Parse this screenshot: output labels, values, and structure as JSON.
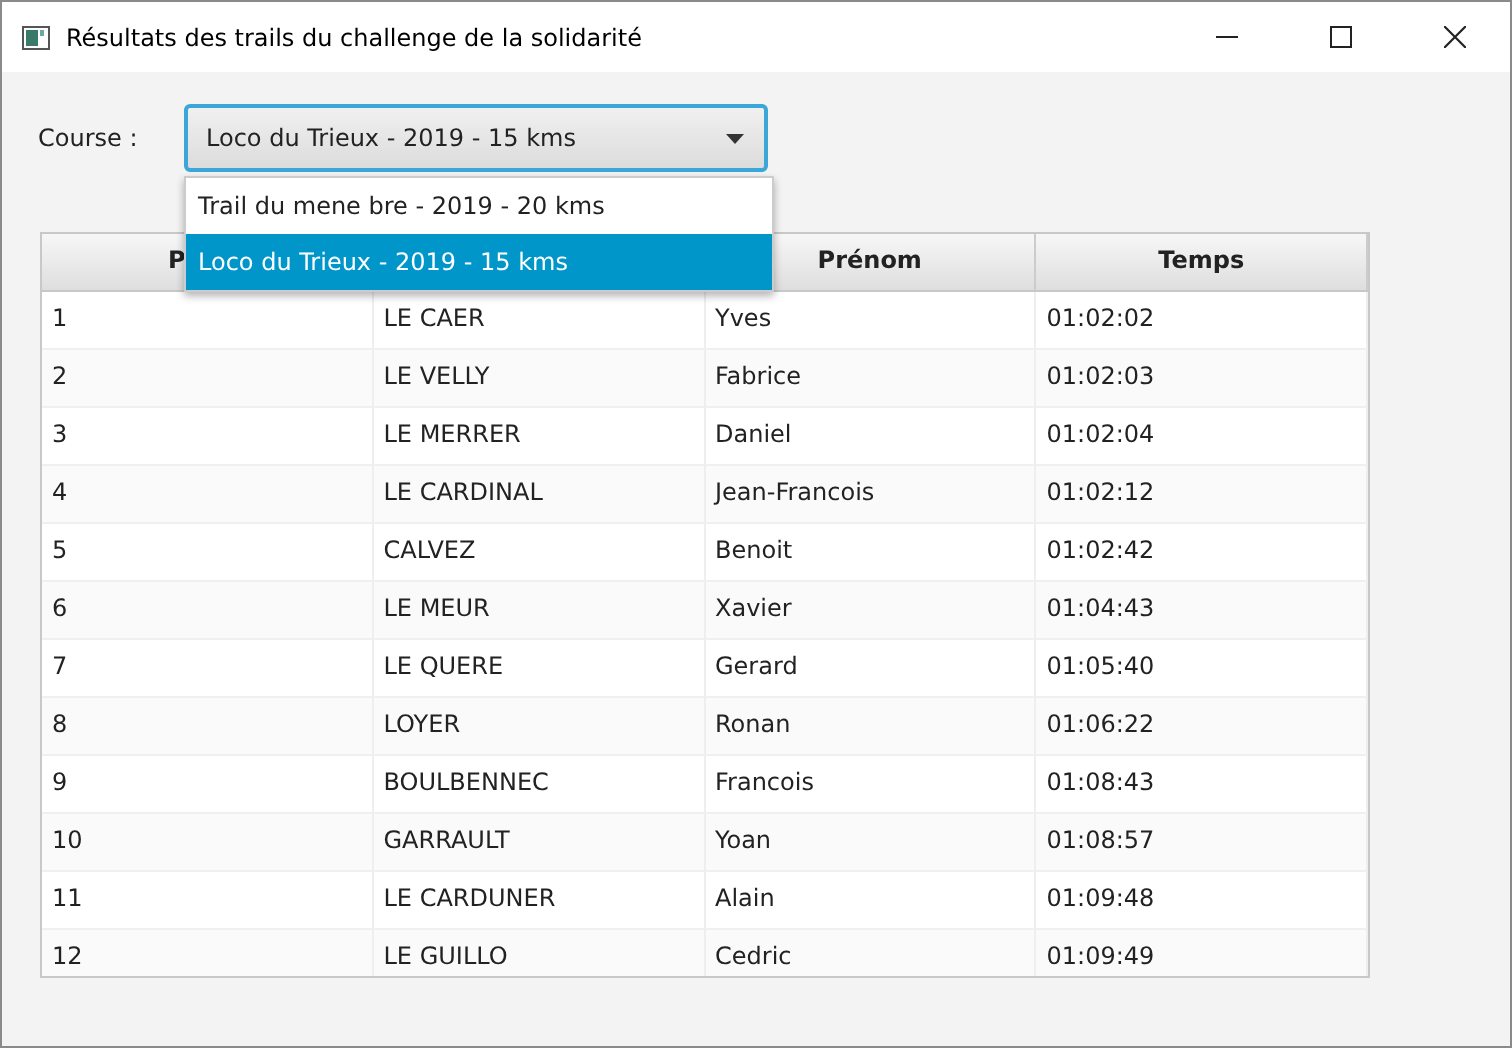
{
  "window": {
    "title": "Résultats des trails du challenge de la solidarité"
  },
  "course": {
    "label": "Course :",
    "value": "Loco du Trieux - 2019 - 15 kms",
    "expanded": true,
    "options": [
      {
        "label": "Trail du mene bre - 2019 - 20 kms",
        "selected": false
      },
      {
        "label": "Loco du Trieux - 2019 - 15 kms",
        "selected": true
      }
    ]
  },
  "table": {
    "columns": [
      {
        "label": "P"
      },
      {},
      {
        "label": "Prénom"
      },
      {
        "label": "Temps"
      }
    ],
    "rows": [
      [
        "1",
        "LE CAER",
        "Yves",
        "01:02:02"
      ],
      [
        "2",
        "LE VELLY",
        "Fabrice",
        "01:02:03"
      ],
      [
        "3",
        "LE MERRER",
        "Daniel",
        "01:02:04"
      ],
      [
        "4",
        "LE CARDINAL",
        "Jean-Francois",
        "01:02:12"
      ],
      [
        "5",
        "CALVEZ",
        "Benoit",
        "01:02:42"
      ],
      [
        "6",
        "LE MEUR",
        "Xavier",
        "01:04:43"
      ],
      [
        "7",
        "LE QUERE",
        "Gerard",
        "01:05:40"
      ],
      [
        "8",
        "LOYER",
        "Ronan",
        "01:06:22"
      ],
      [
        "9",
        "BOULBENNEC",
        "Francois",
        "01:08:43"
      ],
      [
        "10",
        "GARRAULT",
        "Yoan",
        "01:08:57"
      ],
      [
        "11",
        "LE CARDUNER",
        "Alain",
        "01:09:48"
      ],
      [
        "12",
        "LE GUILLO",
        "Cedric",
        "01:09:49"
      ]
    ]
  }
}
